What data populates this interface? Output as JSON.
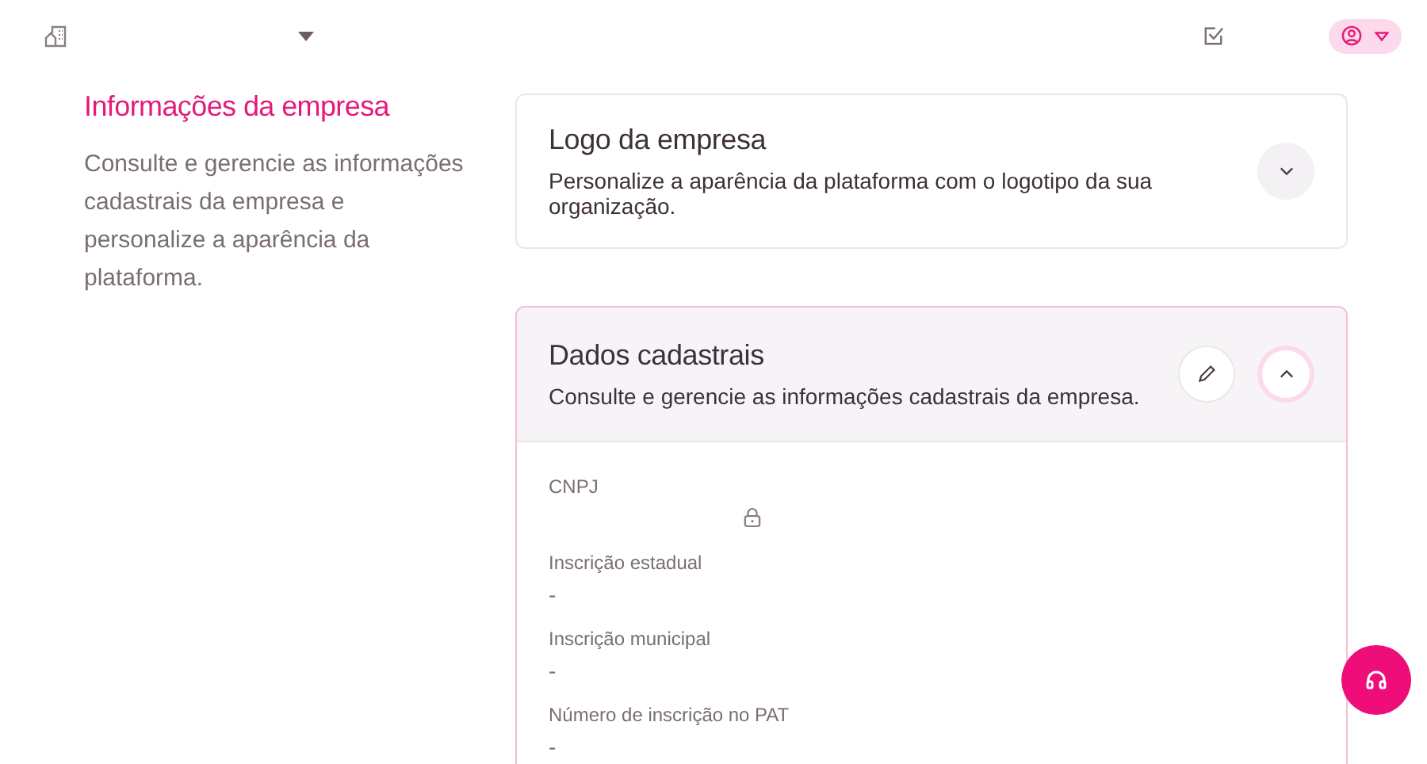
{
  "page": {
    "title": "Informações da empresa",
    "description": "Consulte e gerencie as informações cadastrais da empresa e personalize a aparência da plataforma."
  },
  "sections": [
    {
      "title": "Logo da empresa",
      "description": "Personalize a aparência da plataforma com o logotipo da sua organização.",
      "expanded": false,
      "editable": false
    },
    {
      "title": "Dados cadastrais",
      "description": "Consulte e gerencie as informações cadastrais da empresa.",
      "expanded": true,
      "editable": true,
      "fields": [
        {
          "label": "CNPJ",
          "locked": true
        },
        {
          "label": "Inscrição estadual",
          "value": "-",
          "locked": false
        },
        {
          "label": "Inscrição municipal",
          "value": "-",
          "locked": false
        },
        {
          "label": "Número de inscrição no PAT",
          "value": "-",
          "locked": false
        }
      ]
    }
  ]
}
